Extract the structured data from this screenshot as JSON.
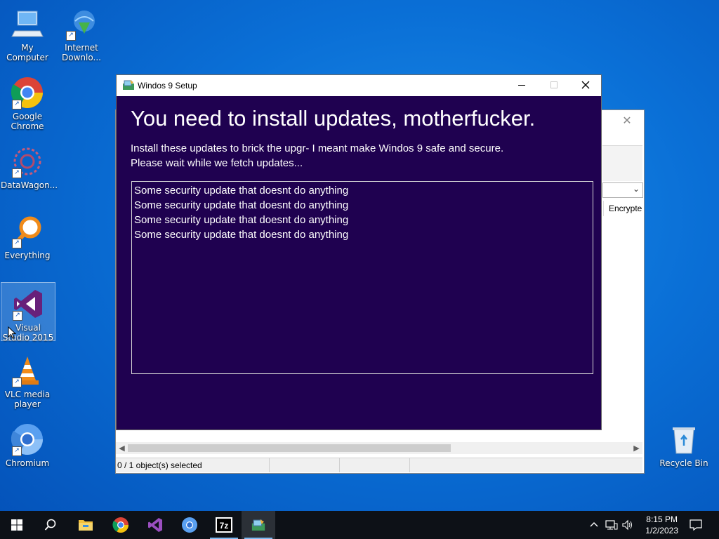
{
  "desktop": {
    "icons": [
      {
        "label": "My Computer",
        "icon": "computer-icon"
      },
      {
        "label": "Internet Downlo...",
        "icon": "download-globe-icon"
      },
      {
        "label": "Google Chrome",
        "icon": "chrome-icon"
      },
      {
        "label": "DataWagon...",
        "icon": "datawagon-icon"
      },
      {
        "label": "Everything",
        "icon": "search-magnifier-icon"
      },
      {
        "label": "Visual Studio 2015",
        "icon": "visual-studio-icon"
      },
      {
        "label": "VLC media player",
        "icon": "vlc-cone-icon"
      },
      {
        "label": "Chromium",
        "icon": "chromium-icon"
      },
      {
        "label": "Recycle Bin",
        "icon": "recycle-bin-icon"
      }
    ]
  },
  "background_window": {
    "close_glyph": "✕",
    "column_header": "Encrypte",
    "status_text": "0 / 1 object(s) selected"
  },
  "setup_window": {
    "title": "Windos 9 Setup",
    "heading": "You need to install updates, motherfucker.",
    "description_line1": "Install these updates to brick the upgr- I meant make Windos 9 safe and secure.",
    "description_line2": "Please wait while we fetch updates...",
    "updates": [
      "Some security update that doesnt do anything",
      "Some security update that doesnt do anything",
      "Some security update that doesnt do anything",
      "Some security update that doesnt do anything"
    ],
    "colors": {
      "background": "#1f0150",
      "text": "#ffffff",
      "titlebar": "#ffffff"
    }
  },
  "taskbar": {
    "items": [
      {
        "name": "start-button",
        "icon": "windows-logo-icon"
      },
      {
        "name": "search-button",
        "icon": "search-icon"
      },
      {
        "name": "file-explorer",
        "icon": "folder-icon"
      },
      {
        "name": "chrome",
        "icon": "chrome-icon"
      },
      {
        "name": "visual-studio",
        "icon": "visual-studio-icon"
      },
      {
        "name": "chromium",
        "icon": "chromium-icon"
      },
      {
        "name": "7zip",
        "icon": "7zip-icon"
      },
      {
        "name": "setup",
        "icon": "setup-icon"
      }
    ],
    "time": "8:15 PM",
    "date": "1/2/2023"
  }
}
